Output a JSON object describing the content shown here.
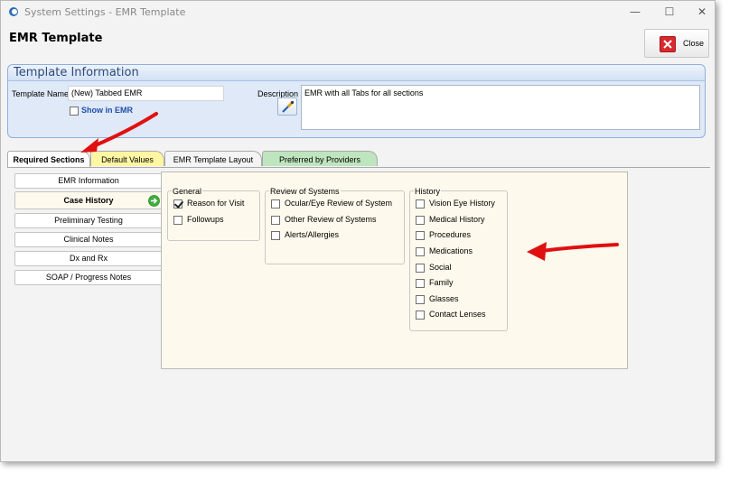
{
  "window": {
    "title": "System Settings - EMR Template",
    "minimize": "—",
    "maximize": "☐",
    "close": "✕"
  },
  "header": {
    "title": "EMR Template",
    "close_label": "Close"
  },
  "template_info": {
    "panel_title": "Template Information",
    "name_label": "Template Name",
    "name_value": "(New) Tabbed EMR",
    "description_label": "Description",
    "description_value": "EMR with all Tabs for all sections",
    "show_in_emr_label": "Show in EMR",
    "show_in_emr_checked": false
  },
  "tabs": [
    {
      "label": "Required Sections",
      "active": true
    },
    {
      "label": "Default Values",
      "active": false
    },
    {
      "label": "EMR Template Layout",
      "active": false
    },
    {
      "label": "Preferred by Providers",
      "active": false
    }
  ],
  "sections": [
    {
      "label": "EMR Information",
      "active": false
    },
    {
      "label": "Case History",
      "active": true
    },
    {
      "label": "Preliminary Testing",
      "active": false
    },
    {
      "label": "Clinical Notes",
      "active": false
    },
    {
      "label": "Dx and Rx",
      "active": false
    },
    {
      "label": "SOAP / Progress Notes",
      "active": false
    }
  ],
  "groups": {
    "general": {
      "title": "General",
      "items": [
        {
          "label": "Reason for Visit",
          "checked": true
        },
        {
          "label": "Followups",
          "checked": false
        }
      ]
    },
    "review": {
      "title": "Review of Systems",
      "items": [
        {
          "label": "Ocular/Eye Review of System",
          "checked": false
        },
        {
          "label": "Other Review of Systems",
          "checked": false
        },
        {
          "label": "Alerts/Allergies",
          "checked": false
        }
      ]
    },
    "history": {
      "title": "History",
      "items": [
        {
          "label": "Vision Eye History",
          "checked": false
        },
        {
          "label": "Medical History",
          "checked": false
        },
        {
          "label": "Procedures",
          "checked": false
        },
        {
          "label": "Medications",
          "checked": false
        },
        {
          "label": "Social",
          "checked": false
        },
        {
          "label": "Family",
          "checked": false
        },
        {
          "label": "Glasses",
          "checked": false
        },
        {
          "label": "Contact Lenses",
          "checked": false
        }
      ]
    }
  },
  "colors": {
    "annotation_arrow": "#e01010",
    "close_icon": "#d8292e",
    "active_section_bg": "#fdf9ec",
    "default_values_tab": "#fff6a3",
    "preferred_tab": "#bfe5bf"
  }
}
